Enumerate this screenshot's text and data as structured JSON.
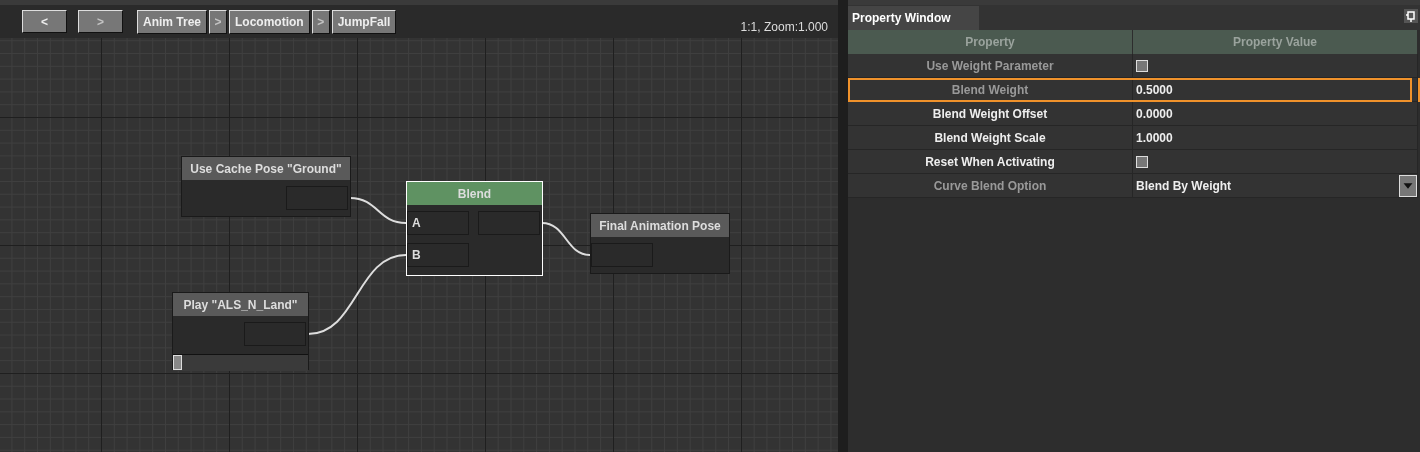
{
  "toolbar": {
    "nav_buttons": [
      {
        "label": "<",
        "disabled": false
      },
      {
        "label": ">",
        "disabled": true
      }
    ],
    "breadcrumbs": [
      {
        "kind": "crumb",
        "label": "Anim Tree"
      },
      {
        "kind": "separator",
        "label": ">"
      },
      {
        "kind": "crumb",
        "label": "Locomotion"
      },
      {
        "kind": "separator",
        "label": ">"
      },
      {
        "kind": "crumb",
        "label": "JumpFall"
      }
    ],
    "zoom_label": "1:1, Zoom:1.000"
  },
  "graph": {
    "nodes": [
      {
        "title": "Use Cache Pose \"Ground\"",
        "color": "#5a5a5a",
        "selected": false,
        "slots": [
          {
            "kind": "output"
          }
        ]
      },
      {
        "title": "Blend",
        "color": "#5f9262",
        "selected": true,
        "slots": [
          {
            "kind": "input",
            "label": "A"
          },
          {
            "kind": "input",
            "label": "B"
          },
          {
            "kind": "output"
          }
        ]
      },
      {
        "title": "Final Animation Pose",
        "color": "#5a5a5a",
        "selected": false,
        "slots": [
          {
            "kind": "input"
          }
        ]
      },
      {
        "title": "Play \"ALS_N_Land\"",
        "color": "#5a5a5a",
        "selected": false,
        "slots": [
          {
            "kind": "output"
          }
        ],
        "playback": {
          "level": 0
        }
      }
    ]
  },
  "property_window": {
    "title": "Property Window",
    "columns": [
      "Property",
      "Property Value"
    ],
    "rows": [
      {
        "name": "Use Weight Parameter",
        "disabled": true,
        "highlighted": false,
        "kind": "checkbox",
        "checked": false
      },
      {
        "name": "Blend Weight",
        "disabled": true,
        "highlighted": true,
        "kind": "text",
        "value": "0.5000"
      },
      {
        "name": "Blend Weight Offset",
        "disabled": false,
        "highlighted": false,
        "kind": "text",
        "value": "0.0000"
      },
      {
        "name": "Blend Weight Scale",
        "disabled": false,
        "highlighted": false,
        "kind": "text",
        "value": "1.0000"
      },
      {
        "name": "Reset When Activating",
        "disabled": false,
        "highlighted": false,
        "kind": "checkbox",
        "checked": false
      },
      {
        "name": "Curve Blend Option",
        "disabled": true,
        "highlighted": false,
        "kind": "dropdown",
        "value": "Blend By Weight"
      }
    ]
  }
}
